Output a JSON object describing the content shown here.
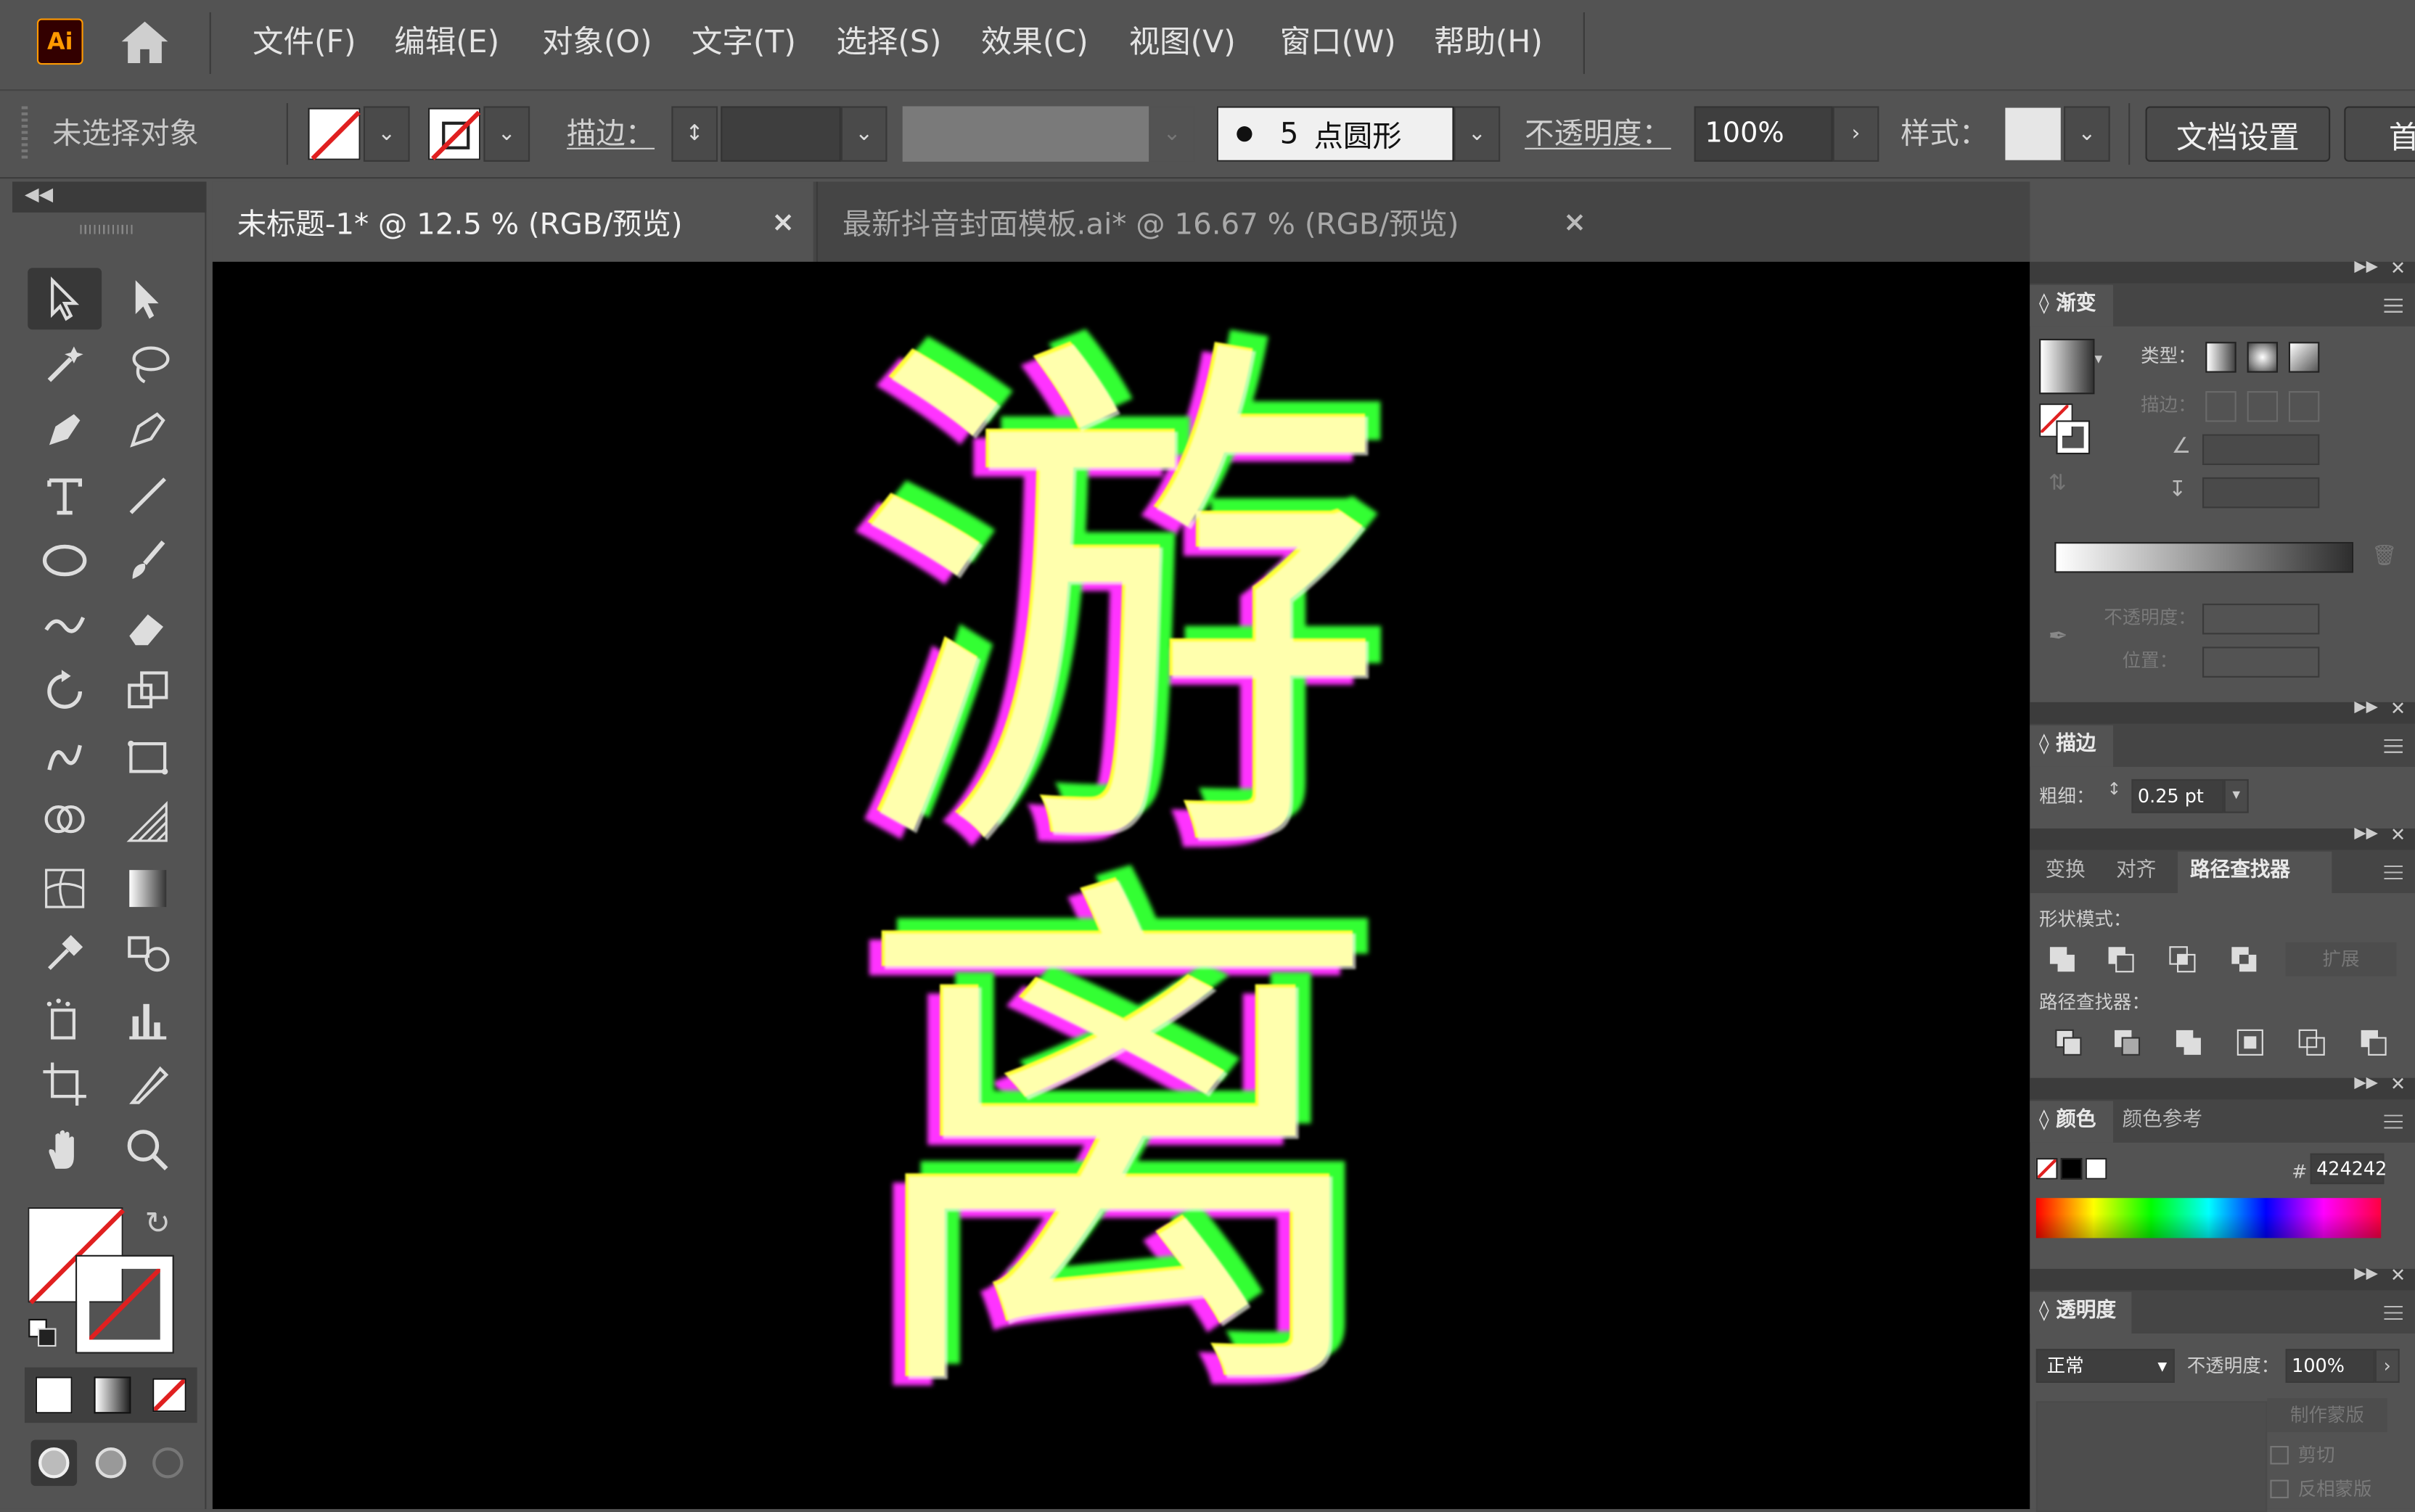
{
  "app": {
    "logo": "Ai"
  },
  "menu": [
    "文件(F)",
    "编辑(E)",
    "对象(O)",
    "文字(T)",
    "选择(S)",
    "效果(C)",
    "视图(V)",
    "窗口(W)",
    "帮助(H)"
  ],
  "control_bar": {
    "no_selection": "未选择对象",
    "stroke_label": "描边：",
    "brush_size": "5",
    "brush_name": "点圆形",
    "opacity_label": "不透明度：",
    "opacity_value": "100%",
    "style_label": "样式：",
    "doc_setup": "文档设置",
    "first_btn": "首"
  },
  "tabs": [
    {
      "label": "未标题-1* @ 12.5 % (RGB/预览)",
      "active": true
    },
    {
      "label": "最新抖音封面模板.ai* @ 16.67 % (RGB/预览)",
      "active": false
    }
  ],
  "tab_close": "×",
  "artwork": {
    "char1": "游",
    "char2": "离",
    "background": "#000000",
    "fill": "#ffff33",
    "shadow1": "#ff33ff",
    "shadow2": "#33ff33"
  },
  "tools": [
    "selection-tool-icon",
    "direct-selection-tool-icon",
    "magic-wand-tool-icon",
    "lasso-tool-icon",
    "pen-tool-icon",
    "curvature-tool-icon",
    "type-tool-icon",
    "line-segment-tool-icon",
    "ellipse-tool-icon",
    "paintbrush-tool-icon",
    "shaper-tool-icon",
    "eraser-tool-icon",
    "rotate-tool-icon",
    "scale-tool-icon",
    "warp-tool-icon",
    "free-transform-tool-icon",
    "shape-builder-tool-icon",
    "perspective-grid-tool-icon",
    "mesh-tool-icon",
    "gradient-tool-icon",
    "eyedropper-tool-icon",
    "blend-tool-icon",
    "symbol-sprayer-tool-icon",
    "column-graph-tool-icon",
    "artboard-tool-icon",
    "slice-tool-icon",
    "hand-tool-icon",
    "zoom-tool-icon"
  ],
  "panels": {
    "gradient": {
      "title": "渐变",
      "type_label": "类型：",
      "stroke_label": "描边：",
      "opacity_label": "不透明度：",
      "location_label": "位置："
    },
    "stroke": {
      "title": "描边",
      "weight_label": "粗细：",
      "weight_value": "0.25 pt"
    },
    "pathfinder": {
      "tabs": [
        "变换",
        "对齐",
        "路径查找器"
      ],
      "shape_modes": "形状模式：",
      "expand": "扩展",
      "pathfinders": "路径查找器："
    },
    "color": {
      "tabs": [
        "颜色",
        "颜色参考"
      ],
      "hex_prefix": "#",
      "hex_value": "424242"
    },
    "transparency": {
      "title": "透明度",
      "blend_mode": "正常",
      "opacity_label": "不透明度：",
      "opacity_value": "100%",
      "make_mask": "制作蒙版",
      "clip": "剪切",
      "invert": "反相蒙版"
    }
  },
  "colors": {
    "accent": "#ff9a00",
    "canvas": "#000000",
    "ui_bg": "#535353",
    "tab_bg": "#454545",
    "active_tab": "#535353"
  }
}
